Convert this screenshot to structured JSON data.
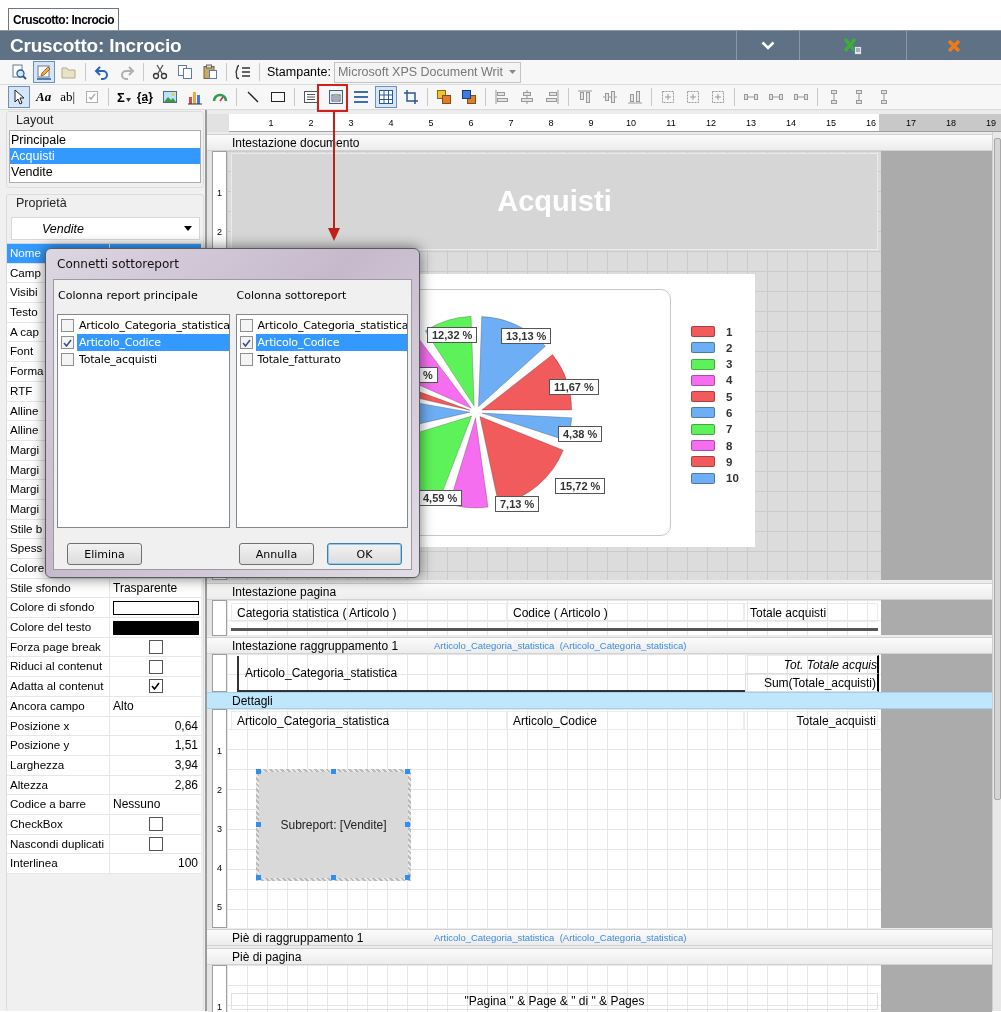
{
  "document_tab": {
    "label": "Cruscotto: Incrocio",
    "selected": true
  },
  "window": {
    "title": "Cruscotto: Incrocio"
  },
  "toolbar": {
    "design_mode": true,
    "pointer_tool": true,
    "grid": true,
    "text_tools": [
      "Aa",
      "ab|",
      "Σ",
      "{a}"
    ],
    "printer_label": "Stampante:",
    "printer_value": "Microsoft XPS Document Writ"
  },
  "layout_panel": {
    "title": "Layout",
    "items": [
      {
        "label": "Principale",
        "selected": false
      },
      {
        "label": "Acquisti",
        "selected": true
      },
      {
        "label": "Vendite",
        "selected": false
      }
    ]
  },
  "properties_panel": {
    "title": "Proprietà",
    "object": "Vendite",
    "rows": [
      {
        "name": "Nome",
        "kind": "empty",
        "selected": true
      },
      {
        "name": "Camp",
        "kind": "empty",
        "selected": false
      },
      {
        "name": "Visibi",
        "kind": "empty",
        "selected": false
      },
      {
        "name": "Testo",
        "kind": "empty",
        "selected": false
      },
      {
        "name": "A cap",
        "kind": "empty",
        "selected": false
      },
      {
        "name": "Font",
        "kind": "empty",
        "selected": false
      },
      {
        "name": "Forma",
        "kind": "empty",
        "selected": false
      },
      {
        "name": "RTF",
        "kind": "empty",
        "selected": false
      },
      {
        "name": "Alline",
        "kind": "empty",
        "selected": false
      },
      {
        "name": "Alline",
        "kind": "empty",
        "selected": false
      },
      {
        "name": "Margi",
        "kind": "empty",
        "selected": false
      },
      {
        "name": "Margi",
        "kind": "empty",
        "selected": false
      },
      {
        "name": "Margi",
        "kind": "empty",
        "selected": false
      },
      {
        "name": "Margi",
        "kind": "empty",
        "selected": false
      },
      {
        "name": "Stile b",
        "kind": "empty",
        "selected": false
      },
      {
        "name": "Spess",
        "kind": "empty",
        "selected": false
      },
      {
        "name": "Colore",
        "kind": "empty",
        "selected": false
      },
      {
        "name": "Stile sfondo",
        "kind": "text",
        "value": "Trasparente",
        "selected": false
      },
      {
        "name": "Colore di sfondo",
        "kind": "color",
        "color": "#ffffff",
        "selected": false
      },
      {
        "name": "Colore del testo",
        "kind": "color",
        "color": "#000000",
        "selected": false
      },
      {
        "name": "Forza page break",
        "kind": "checkbox",
        "checked": false,
        "selected": false
      },
      {
        "name": "Riduci al contenut",
        "kind": "checkbox",
        "checked": false,
        "selected": false
      },
      {
        "name": "Adatta al contenut",
        "kind": "checkbox",
        "checked": true,
        "selected": false
      },
      {
        "name": "Ancora campo",
        "kind": "text",
        "value": "Alto",
        "selected": false
      },
      {
        "name": "Posizione x",
        "kind": "number",
        "value": "0,64",
        "selected": false
      },
      {
        "name": "Posizione y",
        "kind": "number",
        "value": "1,51",
        "selected": false
      },
      {
        "name": "Larghezza",
        "kind": "number",
        "value": "3,94",
        "selected": false
      },
      {
        "name": "Altezza",
        "kind": "number",
        "value": "2,86",
        "selected": false
      },
      {
        "name": "Codice a barre",
        "kind": "text",
        "value": "Nessuno",
        "selected": false
      },
      {
        "name": "CheckBox",
        "kind": "checkbox",
        "checked": false,
        "selected": false
      },
      {
        "name": "Nascondi duplicati",
        "kind": "checkbox",
        "checked": false,
        "selected": false
      },
      {
        "name": "Interlinea",
        "kind": "number",
        "value": "100",
        "selected": false
      }
    ]
  },
  "ruler": {
    "labels": [
      "1",
      "2",
      "3",
      "4",
      "5",
      "6",
      "7",
      "8",
      "9",
      "10",
      "11",
      "12",
      "13",
      "14",
      "15",
      "16",
      "17",
      "18",
      "19"
    ]
  },
  "sections": [
    {
      "kind": "document_header",
      "band": "Intestazione documento",
      "selected": false,
      "ruler": [
        "1",
        "2"
      ],
      "title": "Acquisti",
      "chart": {
        "labels": [
          "%",
          "12,32 %",
          "13,13 %",
          "11,67 %",
          "4,38 %",
          "15,72 %",
          "7,13 %",
          "4,59 %"
        ],
        "legend": [
          {
            "label": "1",
            "color": "#f25b5b"
          },
          {
            "label": "2",
            "color": "#6eaef4"
          },
          {
            "label": "3",
            "color": "#5ef25a"
          },
          {
            "label": "4",
            "color": "#f56ef0"
          },
          {
            "label": "5",
            "color": "#f25b5b"
          },
          {
            "label": "6",
            "color": "#6eaef4"
          },
          {
            "label": "7",
            "color": "#5ef25a"
          },
          {
            "label": "8",
            "color": "#f56ef0"
          },
          {
            "label": "9",
            "color": "#f25b5b"
          },
          {
            "label": "10",
            "color": "#6eaef4"
          }
        ]
      }
    },
    {
      "kind": "page_header",
      "band": "Intestazione pagina",
      "selected": false,
      "fields": [
        "Categoria statistica ( Articolo )",
        "Codice ( Articolo )",
        "Totale acquisti"
      ]
    },
    {
      "kind": "group_header",
      "band": "Intestazione raggruppamento 1",
      "selected": false,
      "group_info": "Articolo_Categoria_statistica  (Articolo_Categoria_statistica)",
      "fields": [
        "Articolo_Categoria_statistica",
        "Tot. Totale acquis",
        "Sum(Totale_acquisti)"
      ]
    },
    {
      "kind": "details",
      "band": "Dettagli",
      "selected": true,
      "ruler": [
        "1",
        "2",
        "3",
        "4",
        "5"
      ],
      "fields": [
        "Articolo_Categoria_statistica",
        "Articolo_Codice",
        "Totale_acquisti"
      ],
      "subreport": "Subreport: [Vendite]"
    },
    {
      "kind": "group_footer",
      "band": "Piè di raggruppamento 1",
      "selected": false,
      "group_info": "Articolo_Categoria_statistica  (Articolo_Categoria_statistica)"
    },
    {
      "kind": "page_footer",
      "band": "Piè di pagina",
      "selected": false,
      "ruler": [
        "1"
      ],
      "fields": [
        "\"Pagina \" & Page & \" di \" & Pages"
      ]
    }
  ],
  "dialog": {
    "title": "Connetti sottoreport",
    "columns": [
      {
        "header": "Colonna report principale",
        "items": [
          {
            "label": "Articolo_Categoria_statistica",
            "checked": false,
            "selected": false
          },
          {
            "label": "Articolo_Codice",
            "checked": true,
            "selected": true
          },
          {
            "label": "Totale_acquisti",
            "checked": false,
            "selected": false
          }
        ]
      },
      {
        "header": "Colonna sottoreport",
        "items": [
          {
            "label": "Articolo_Categoria_statistica",
            "checked": false,
            "selected": false
          },
          {
            "label": "Articolo_Codice",
            "checked": true,
            "selected": true
          },
          {
            "label": "Totale_fatturato",
            "checked": false,
            "selected": false
          }
        ]
      }
    ],
    "buttons": [
      {
        "label": "Elimina",
        "default": false
      },
      {
        "label": "Annulla",
        "default": false
      },
      {
        "label": "OK",
        "default": true
      }
    ]
  }
}
